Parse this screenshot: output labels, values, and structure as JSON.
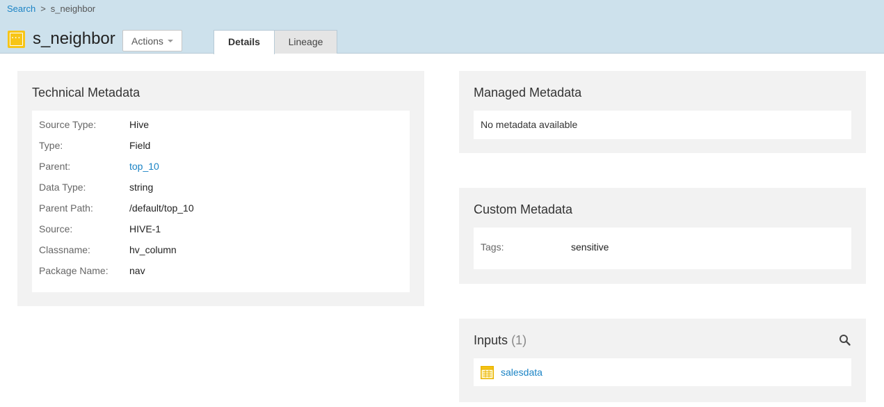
{
  "breadcrumb": {
    "root": "Search",
    "separator": ">",
    "current": "s_neighbor"
  },
  "entity": {
    "icon": "field-icon",
    "title": "s_neighbor"
  },
  "actions": {
    "label": "Actions"
  },
  "tabs": [
    {
      "label": "Details",
      "active": true
    },
    {
      "label": "Lineage",
      "active": false
    }
  ],
  "technical": {
    "title": "Technical Metadata",
    "rows": [
      {
        "label": "Source Type:",
        "value": "Hive"
      },
      {
        "label": "Type:",
        "value": "Field"
      },
      {
        "label": "Parent:",
        "value": "top_10"
      },
      {
        "label": "Data Type:",
        "value": "string"
      },
      {
        "label": "Parent Path:",
        "value": "/default/top_10"
      },
      {
        "label": "Source:",
        "value": "HIVE-1"
      },
      {
        "label": "Classname:",
        "value": "hv_column"
      },
      {
        "label": "Package Name:",
        "value": "nav"
      }
    ]
  },
  "managed": {
    "title": "Managed Metadata",
    "empty_text": "No metadata available"
  },
  "custom": {
    "title": "Custom Metadata",
    "tags_label": "Tags:",
    "tags_value": "sensitive"
  },
  "inputs": {
    "title": "Inputs",
    "count": "(1)",
    "items": [
      {
        "name": "salesdata",
        "icon": "table-icon"
      }
    ]
  },
  "colors": {
    "header_bg": "#cde1ec",
    "link": "#1a83c5",
    "icon_yellow": "#f7c517",
    "panel_bg": "#f2f2f2"
  }
}
